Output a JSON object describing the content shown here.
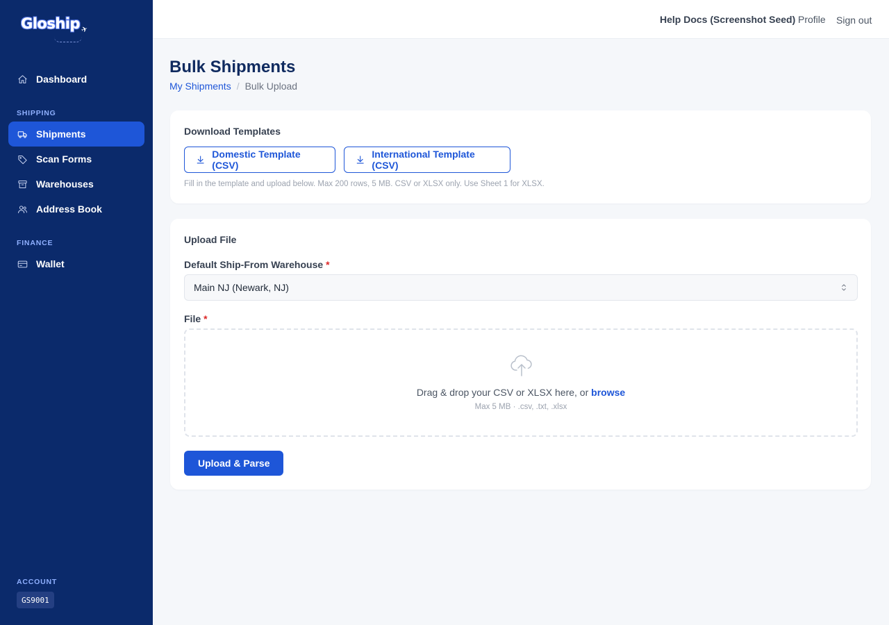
{
  "app": {
    "logo_text": "Gloship",
    "logo_plane": "✈"
  },
  "sidebar": {
    "dashboard_label": "Dashboard",
    "shipping_section": "SHIPPING",
    "items": [
      {
        "label": "Shipments",
        "icon": "truck-icon",
        "active": true
      },
      {
        "label": "Scan Forms",
        "icon": "tag-icon",
        "active": false
      },
      {
        "label": "Warehouses",
        "icon": "archive-icon",
        "active": false
      },
      {
        "label": "Address Book",
        "icon": "users-icon",
        "active": false
      }
    ],
    "finance_section": "FINANCE",
    "wallet_label": "Wallet",
    "account_section": "ACCOUNT",
    "account_id": "GS9001"
  },
  "topbar": {
    "help_docs": "Help Docs (Screenshot Seed)",
    "profile": "Profile",
    "sign_out": "Sign out"
  },
  "page": {
    "title": "Bulk Shipments",
    "breadcrumb": {
      "parent": "My Shipments",
      "separator": "/",
      "current": "Bulk Upload"
    }
  },
  "templates_card": {
    "title": "Download Templates",
    "domestic_button": "Domestic Template (CSV)",
    "international_button": "International Template (CSV)",
    "hint": "Fill in the template and upload below. Max 200 rows, 5 MB. CSV or XLSX only. Use Sheet 1 for XLSX."
  },
  "upload_card": {
    "title": "Upload File",
    "warehouse_label": "Default Ship-From Warehouse",
    "warehouse_value": "Main NJ (Newark, NJ)",
    "file_label": "File",
    "required_mark": "*",
    "dropzone_text": "Drag & drop your CSV or XLSX here, or",
    "dropzone_browse": "browse",
    "dropzone_sub": "Max 5 MB · .csv, .txt, .xlsx",
    "submit_button": "Upload & Parse"
  },
  "colors": {
    "sidebar_bg": "#0b2a6b",
    "accent": "#1e56d8",
    "page_bg": "#f5f7fa",
    "required": "#dc2626"
  }
}
